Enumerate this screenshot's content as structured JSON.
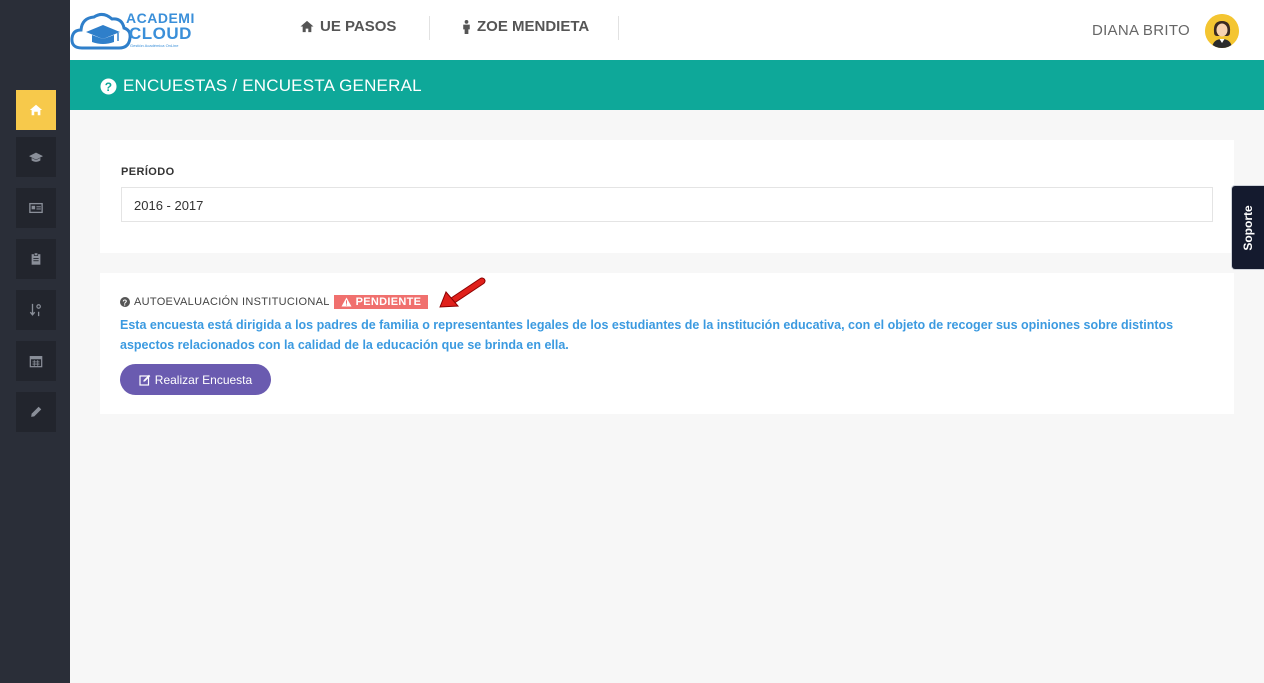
{
  "header": {
    "logo_line1": "ACADEMI",
    "logo_line2": "CLOUD",
    "logo_sub": "Gestión Académica OnLine",
    "nav": [
      {
        "label": "UE PASOS",
        "icon": "home-icon"
      },
      {
        "label": "ZOE MENDIETA",
        "icon": "user-icon"
      }
    ],
    "user_name": "DIANA BRITO"
  },
  "sidebar": {
    "items": [
      {
        "icon": "home-icon",
        "active": true
      },
      {
        "icon": "graduation-cap-icon",
        "active": false
      },
      {
        "icon": "id-card-icon",
        "active": false
      },
      {
        "icon": "clipboard-icon",
        "active": false
      },
      {
        "icon": "sort-numeric-icon",
        "active": false
      },
      {
        "icon": "calendar-icon",
        "active": false
      },
      {
        "icon": "pencil-icon",
        "active": false
      }
    ]
  },
  "titlebar": {
    "title": "ENCUESTAS / ENCUESTA GENERAL"
  },
  "period": {
    "label": "PERÍODO",
    "value": "2016 - 2017"
  },
  "survey": {
    "title": "AUTOEVALUACIÓN INSTITUCIONAL",
    "status": "PENDIENTE",
    "description": "Esta encuesta está dirigida a los padres de familia o representantes legales de los estudiantes de la institución educativa, con el objeto de recoger sus opiniones sobre distintos aspectos relacionados con la calidad de la educación que se brinda en ella.",
    "button_label": "Realizar Encuesta"
  },
  "support_tab": "Soporte",
  "colors": {
    "sidebar": "#2a2e38",
    "teal": "#0ea899",
    "active": "#f7c94b",
    "badge": "#f0706e",
    "link": "#3b9ae0",
    "button": "#6a5bb0"
  }
}
